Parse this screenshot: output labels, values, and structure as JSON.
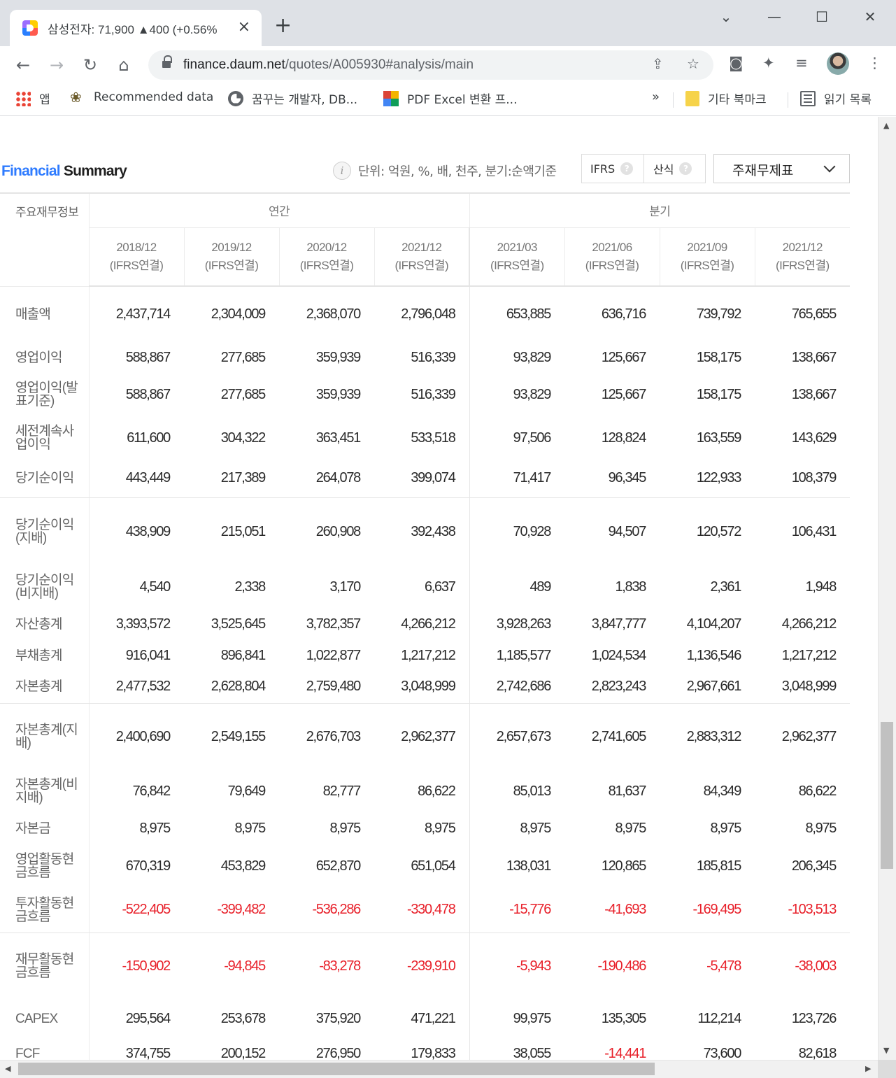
{
  "browser": {
    "tab_title": "삼성전자: 71,900 ▲400 (+0.56%",
    "url_host": "finance.daum.net",
    "url_path": "/quotes/A005930#analysis/main",
    "bookmarks": [
      "앱",
      "Recommended data",
      "꿈꾸는 개발자, DB...",
      "PDF Excel 변환 프...",
      "기타 북마크",
      "읽기 목록"
    ],
    "overflow": "»"
  },
  "section": {
    "title_blue": "Financial",
    "title_black": "Summary",
    "unit_text": "단위: 억원, %, 배, 천주, 분기:순액기준",
    "ifrs_label": "IFRS",
    "formula_label": "산식",
    "select_value": "주재무제표"
  },
  "table": {
    "label_header": "주요재무정보",
    "group_annual": "연간",
    "group_quarter": "분기",
    "periods": [
      {
        "date": "2018/12",
        "basis": "(IFRS연결)"
      },
      {
        "date": "2019/12",
        "basis": "(IFRS연결)"
      },
      {
        "date": "2020/12",
        "basis": "(IFRS연결)"
      },
      {
        "date": "2021/12",
        "basis": "(IFRS연결)"
      },
      {
        "date": "2021/03",
        "basis": "(IFRS연결)"
      },
      {
        "date": "2021/06",
        "basis": "(IFRS연결)"
      },
      {
        "date": "2021/09",
        "basis": "(IFRS연결)"
      },
      {
        "date": "2021/12",
        "basis": "(IFRS연결)"
      }
    ],
    "rows": [
      {
        "label": "매출액",
        "values": [
          "2,437,714",
          "2,304,009",
          "2,368,070",
          "2,796,048",
          "653,885",
          "636,716",
          "739,792",
          "765,655"
        ]
      },
      {
        "label": "영업이익",
        "values": [
          "588,867",
          "277,685",
          "359,939",
          "516,339",
          "93,829",
          "125,667",
          "158,175",
          "138,667"
        ]
      },
      {
        "label": "영업이익(발표기준)",
        "values": [
          "588,867",
          "277,685",
          "359,939",
          "516,339",
          "93,829",
          "125,667",
          "158,175",
          "138,667"
        ]
      },
      {
        "label": "세전계속사업이익",
        "values": [
          "611,600",
          "304,322",
          "363,451",
          "533,518",
          "97,506",
          "128,824",
          "163,559",
          "143,629"
        ]
      },
      {
        "label": "당기순이익",
        "values": [
          "443,449",
          "217,389",
          "264,078",
          "399,074",
          "71,417",
          "96,345",
          "122,933",
          "108,379"
        ]
      },
      {
        "label": "당기순이익(지배)",
        "values": [
          "438,909",
          "215,051",
          "260,908",
          "392,438",
          "70,928",
          "94,507",
          "120,572",
          "106,431"
        ]
      },
      {
        "label": "당기순이익(비지배)",
        "values": [
          "4,540",
          "2,338",
          "3,170",
          "6,637",
          "489",
          "1,838",
          "2,361",
          "1,948"
        ]
      },
      {
        "label": "자산총계",
        "values": [
          "3,393,572",
          "3,525,645",
          "3,782,357",
          "4,266,212",
          "3,928,263",
          "3,847,777",
          "4,104,207",
          "4,266,212"
        ]
      },
      {
        "label": "부채총계",
        "values": [
          "916,041",
          "896,841",
          "1,022,877",
          "1,217,212",
          "1,185,577",
          "1,024,534",
          "1,136,546",
          "1,217,212"
        ]
      },
      {
        "label": "자본총계",
        "values": [
          "2,477,532",
          "2,628,804",
          "2,759,480",
          "3,048,999",
          "2,742,686",
          "2,823,243",
          "2,967,661",
          "3,048,999"
        ]
      },
      {
        "label": "자본총계(지배)",
        "values": [
          "2,400,690",
          "2,549,155",
          "2,676,703",
          "2,962,377",
          "2,657,673",
          "2,741,605",
          "2,883,312",
          "2,962,377"
        ]
      },
      {
        "label": "자본총계(비지배)",
        "values": [
          "76,842",
          "79,649",
          "82,777",
          "86,622",
          "85,013",
          "81,637",
          "84,349",
          "86,622"
        ]
      },
      {
        "label": "자본금",
        "values": [
          "8,975",
          "8,975",
          "8,975",
          "8,975",
          "8,975",
          "8,975",
          "8,975",
          "8,975"
        ]
      },
      {
        "label": "영업활동현금흐름",
        "values": [
          "670,319",
          "453,829",
          "652,870",
          "651,054",
          "138,031",
          "120,865",
          "185,815",
          "206,345"
        ]
      },
      {
        "label": "투자활동현금흐름",
        "values": [
          "-522,405",
          "-399,482",
          "-536,286",
          "-330,478",
          "-15,776",
          "-41,693",
          "-169,495",
          "-103,513"
        ]
      },
      {
        "label": "재무활동현금흐름",
        "values": [
          "-150,902",
          "-94,845",
          "-83,278",
          "-239,910",
          "-5,943",
          "-190,486",
          "-5,478",
          "-38,003"
        ]
      },
      {
        "label": "CAPEX",
        "values": [
          "295,564",
          "253,678",
          "375,920",
          "471,221",
          "99,975",
          "135,305",
          "112,214",
          "123,726"
        ]
      },
      {
        "label": "FCF",
        "values": [
          "374,755",
          "200,152",
          "276,950",
          "179,833",
          "38,055",
          "-14,441",
          "73,600",
          "82,618"
        ]
      }
    ]
  },
  "colors": {
    "accent_blue": "#2e7bff",
    "negative_red": "#e8202a"
  }
}
